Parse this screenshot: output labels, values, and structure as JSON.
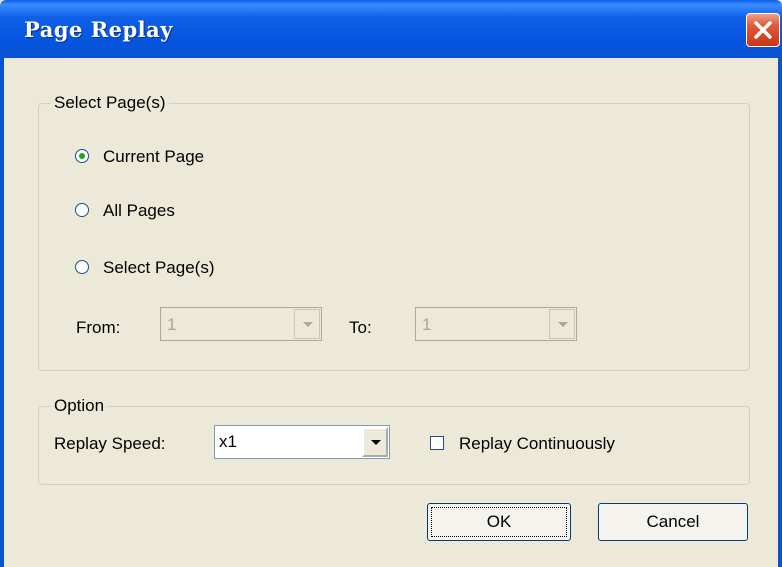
{
  "window": {
    "title": "Page Replay"
  },
  "select_pages_group": {
    "label": "Select Page(s)",
    "options": [
      {
        "label": "Current Page",
        "checked": true
      },
      {
        "label": "All Pages",
        "checked": false
      },
      {
        "label": "Select Page(s)",
        "checked": false
      }
    ],
    "from_label": "From:",
    "from_value": "1",
    "to_label": "To:",
    "to_value": "1"
  },
  "option_group": {
    "label": "Option",
    "replay_speed_label": "Replay Speed:",
    "replay_speed_value": "x1",
    "replay_continuously_label": "Replay Continuously",
    "replay_continuously_checked": false
  },
  "buttons": {
    "ok": "OK",
    "cancel": "Cancel"
  },
  "icons": {
    "close": "close-icon",
    "dropdown": "chevron-down-icon"
  },
  "colors": {
    "title_bar": "#0555e0",
    "dialog_bg": "#ece9d8",
    "close_button": "#e05a3a"
  }
}
